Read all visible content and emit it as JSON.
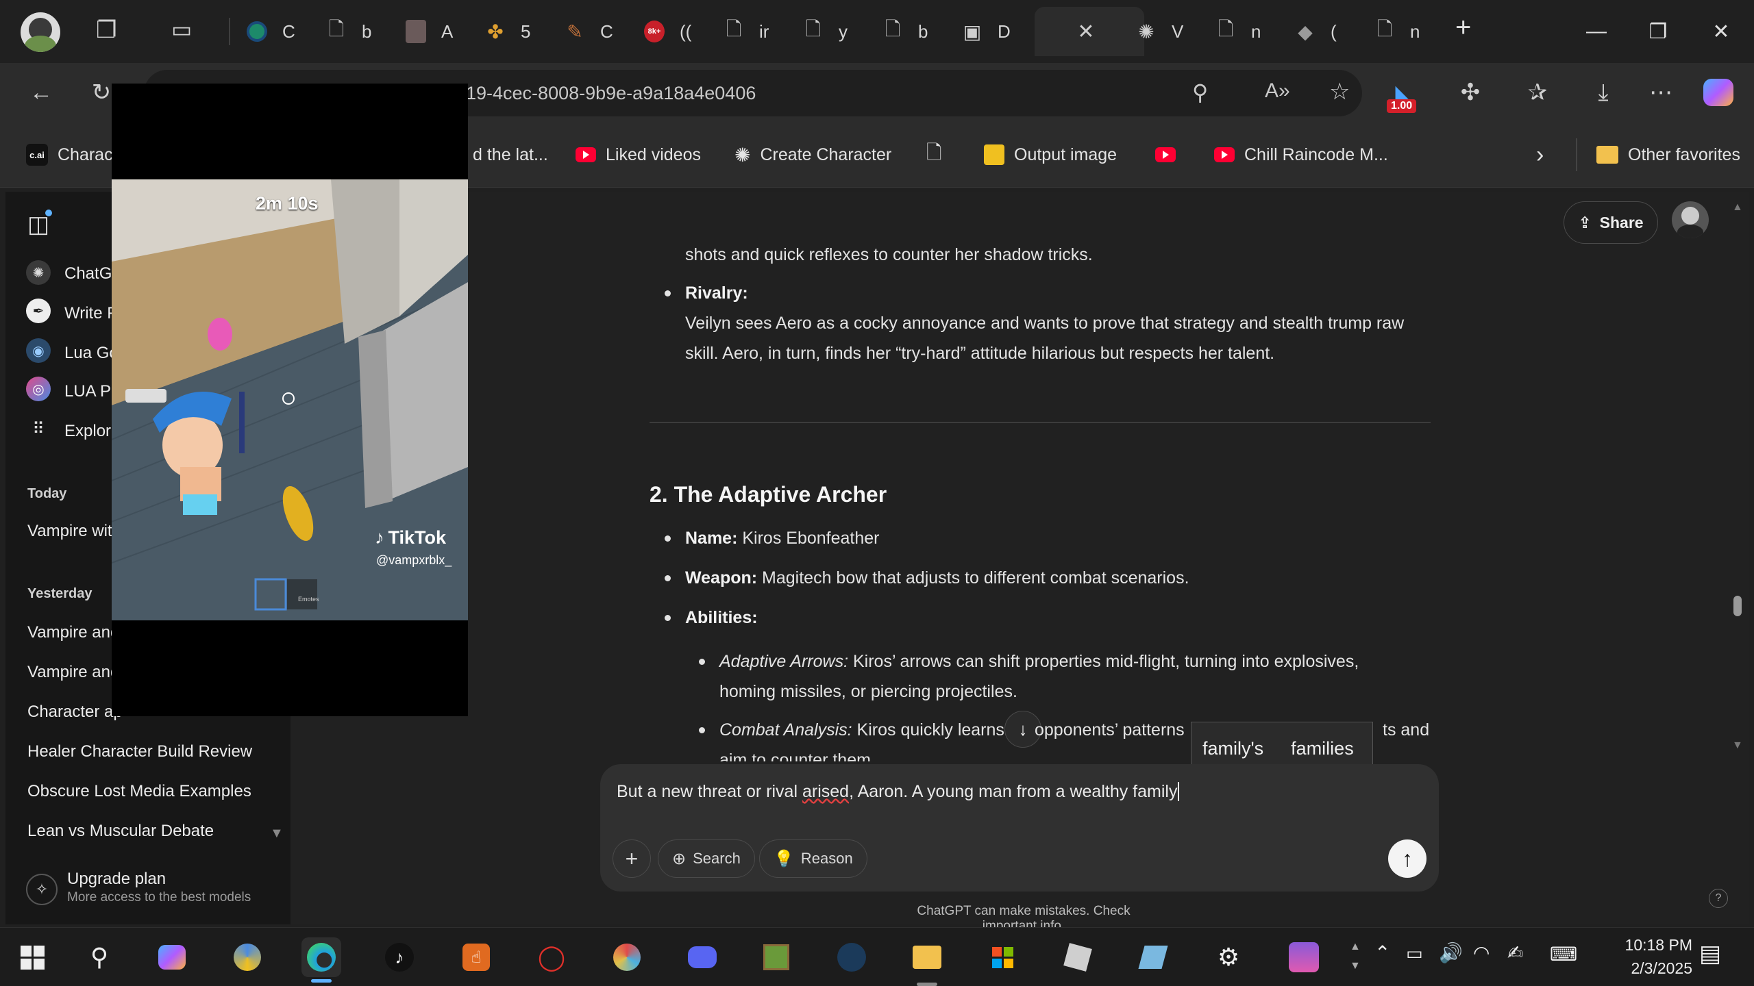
{
  "browser": {
    "tabs": [
      {
        "label": "C",
        "icon": "chatgpt-green-icon"
      },
      {
        "label": "b",
        "icon": "page-icon"
      },
      {
        "label": "A",
        "icon": "image-icon"
      },
      {
        "label": "5",
        "icon": "pinwheel-icon"
      },
      {
        "label": "C",
        "icon": "brush-icon"
      },
      {
        "label": "((",
        "icon": "badge-icon"
      },
      {
        "label": "ir",
        "icon": "page-icon"
      },
      {
        "label": "y",
        "icon": "page-icon"
      },
      {
        "label": "b",
        "icon": "page-icon"
      },
      {
        "label": "D",
        "icon": "photo-icon"
      },
      {
        "label": "V",
        "icon": "openai-icon"
      },
      {
        "label": "n",
        "icon": "page-icon"
      },
      {
        "label": "(",
        "icon": "roblox-icon"
      },
      {
        "label": "n",
        "icon": "page-icon"
      }
    ],
    "url": "19-4cec-8008-9b9e-a9a18a4e0406",
    "extension_badge": "1.00",
    "favorites": [
      {
        "label": "Charact",
        "icon": "cai-icon"
      },
      {
        "label": "d the lat...",
        "icon": ""
      },
      {
        "label": "Liked videos",
        "icon": "youtube-icon"
      },
      {
        "label": "Create Character",
        "icon": "openai-icon"
      },
      {
        "label": "",
        "icon": "page-icon"
      },
      {
        "label": "Output image",
        "icon": "output-icon"
      },
      {
        "label": "",
        "icon": "youtube-icon"
      },
      {
        "label": "Chill Raincode M...",
        "icon": "youtube-icon"
      },
      {
        "label": "Other favorites",
        "icon": "folder-icon"
      }
    ]
  },
  "sidebar": {
    "gpts": [
      "ChatGF",
      "Write F",
      "Lua Go",
      "LUA Pr",
      "Explore"
    ],
    "sections": [
      {
        "heading": "Today",
        "items": [
          "Vampire with"
        ]
      },
      {
        "heading": "Yesterday",
        "items": [
          "Vampire and",
          "Vampire and",
          "Character ap",
          "Healer Character Build Review",
          "Obscure Lost Media Examples",
          "Lean vs Muscular Debate"
        ]
      }
    ],
    "upgrade_title": "Upgrade plan",
    "upgrade_sub": "More access to the best models"
  },
  "header": {
    "share": "Share"
  },
  "content": {
    "prev_line": "shots and quick reflexes to counter her shadow tricks.",
    "rivalry_label": "Rivalry:",
    "rivalry_line1": "Veilyn sees Aero as a cocky annoyance and wants to prove that strategy and stealth trump raw",
    "rivalry_line2": "skill. Aero, in turn, finds her “try-hard” attitude hilarious but respects her talent.",
    "section_title": "2. The Adaptive Archer",
    "name_label": "Name:",
    "name_value": "Kiros Ebonfeather",
    "weapon_label": "Weapon:",
    "weapon_value": "Magitech bow that adjusts to different combat scenarios.",
    "abilities_label": "Abilities:",
    "ab1_label": "Adaptive Arrows:",
    "ab1_line1": "Kiros’ arrows can shift properties mid-flight, turning into explosives,",
    "ab1_line2": "homing missiles, or piercing projectiles.",
    "ab2_label": "Combat Analysis:",
    "ab2_line1a": "Kiros quickly learns",
    "ab2_line1b": "opponents’ patterns",
    "ab2_line1c": "ts and",
    "ab2_line2": "aim to counter them"
  },
  "spellcheck": [
    "family's",
    "families"
  ],
  "composer": {
    "text_before": "But a new threat or rival ",
    "misspelled": "arised",
    "text_after": ", Aaron. A young man from a wealthy family",
    "search": "Search",
    "reason": "Reason"
  },
  "disclaimer": "ChatGPT can make mistakes. Check important info.",
  "video": {
    "timer": "2m 10s",
    "brand": "TikTok",
    "handle": "@vampxrblx_",
    "emotes": "Emotes"
  },
  "taskbar": {
    "time": "10:18 PM",
    "date": "2/3/2025"
  },
  "colors": {
    "accent": "#5fb3ff",
    "youtube": "#ff0033",
    "ext_badge": "#d4202a"
  }
}
